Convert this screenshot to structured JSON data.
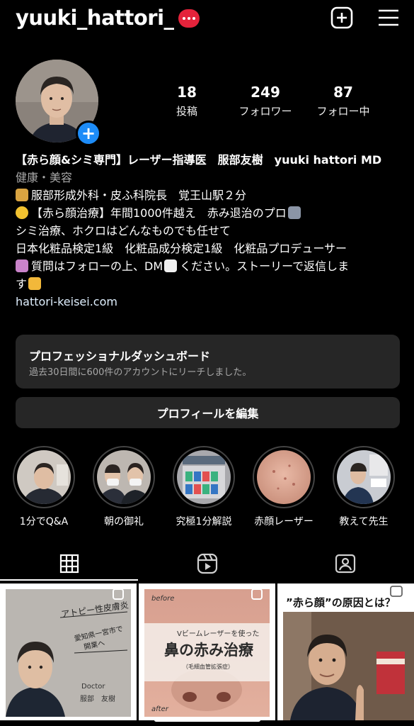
{
  "header": {
    "username": "yuuki_hattori_",
    "notification_badge": "•••",
    "icons": [
      "plus-square-icon",
      "hamburger-menu-icon"
    ]
  },
  "stats": [
    {
      "value": "18",
      "label": "投稿"
    },
    {
      "value": "249",
      "label": "フォロワー"
    },
    {
      "value": "87",
      "label": "フォロー中"
    }
  ],
  "bio": {
    "name": "【赤ら顔&シミ専門】レーザー指導医　服部友樹　yuuki hattori MD",
    "category": "健康・美容",
    "line1": "服部形成外科・皮ふ科院長　覚王山駅２分",
    "line2": "【赤ら顔治療】年間1000件越え　赤み退治のプロ",
    "line3": "シミ治療、ホクロはどんなものでも任せて",
    "line4": "日本化粧品検定1級　化粧品成分検定1級　化粧品プロデューサー",
    "line5a": "質問はフォローの上、DM",
    "line5b": "ください。ストーリーで返信しま",
    "line5c": "す",
    "link": "hattori-keisei.com"
  },
  "dashboard": {
    "title": "プロフェッショナルダッシュボード",
    "subtitle": "過去30日間に600件のアカウントにリーチしました。"
  },
  "edit_profile_label": "プロフィールを編集",
  "highlights": [
    {
      "label": "1分でQ&A"
    },
    {
      "label": "朝の御礼"
    },
    {
      "label": "究極1分解説"
    },
    {
      "label": "赤顔レーザー"
    },
    {
      "label": "教えて先生"
    }
  ],
  "tabs": [
    "grid-icon",
    "reels-icon",
    "tagged-icon"
  ],
  "posts": [
    {
      "title": "アトピー性皮膚炎",
      "sub1": "愛知県一宮市で",
      "sub2": "開業へ",
      "sign1": "Doctor",
      "sign2": "服部　友樹"
    },
    {
      "top": "before",
      "small": "Vビームレーザーを使った",
      "big": "鼻の赤み治療",
      "note": "（毛細血管拡張症）",
      "bottom": "after"
    },
    {
      "title": "”赤ら顔”の原因とは？"
    }
  ],
  "colors": {
    "background": "#000000",
    "card": "#262626",
    "accent": "#1d8cf8",
    "badge": "#e4233b"
  }
}
